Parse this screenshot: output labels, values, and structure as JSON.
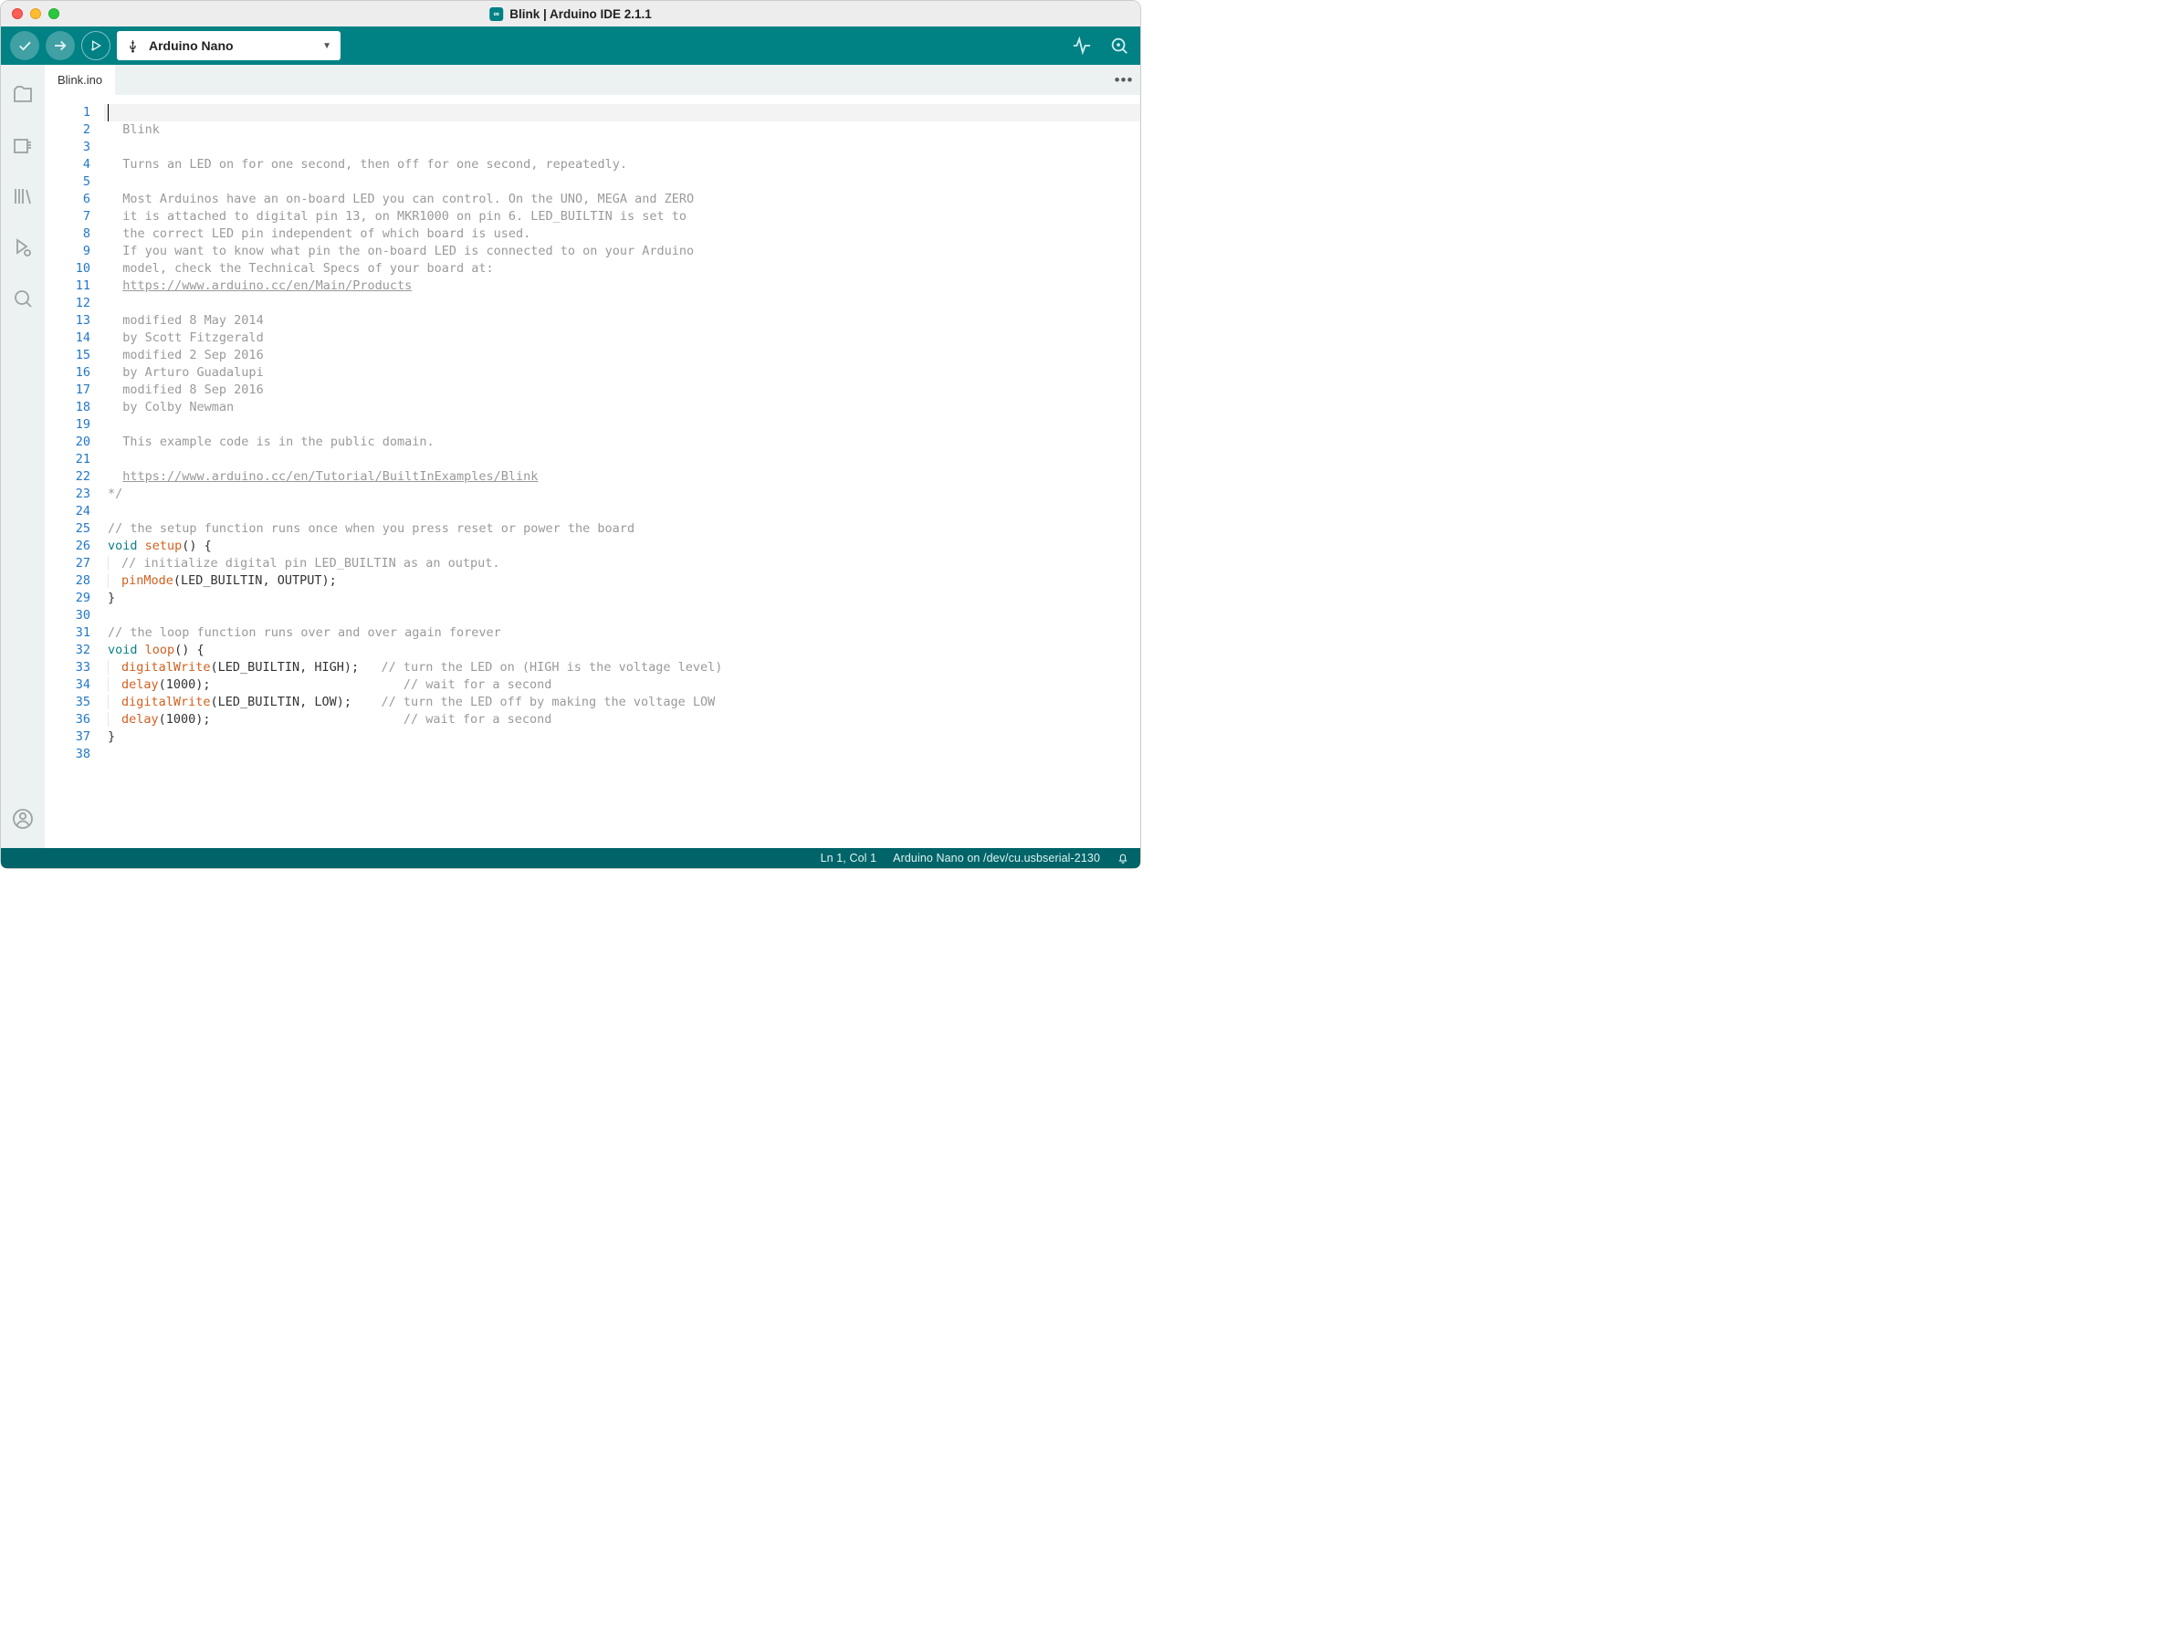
{
  "window": {
    "title": "Blink | Arduino IDE 2.1.1"
  },
  "toolbar": {
    "board_label": "Arduino Nano"
  },
  "tabs": {
    "active": "Blink.ino"
  },
  "status": {
    "position": "Ln 1, Col 1",
    "board_port": "Arduino Nano on /dev/cu.usbserial-2130"
  },
  "code": {
    "lines": [
      {
        "t": "comment",
        "text": "/*"
      },
      {
        "t": "comment",
        "indent": 1,
        "text": "Blink"
      },
      {
        "t": "blank"
      },
      {
        "t": "comment",
        "indent": 1,
        "text": "Turns an LED on for one second, then off for one second, repeatedly."
      },
      {
        "t": "blank"
      },
      {
        "t": "comment",
        "indent": 1,
        "text": "Most Arduinos have an on-board LED you can control. On the UNO, MEGA and ZERO"
      },
      {
        "t": "comment",
        "indent": 1,
        "text": "it is attached to digital pin 13, on MKR1000 on pin 6. LED_BUILTIN is set to"
      },
      {
        "t": "comment",
        "indent": 1,
        "text": "the correct LED pin independent of which board is used."
      },
      {
        "t": "comment",
        "indent": 1,
        "text": "If you want to know what pin the on-board LED is connected to on your Arduino"
      },
      {
        "t": "comment",
        "indent": 1,
        "text": "model, check the Technical Specs of your board at:"
      },
      {
        "t": "link",
        "indent": 1,
        "text": "https://www.arduino.cc/en/Main/Products"
      },
      {
        "t": "blank"
      },
      {
        "t": "comment",
        "indent": 1,
        "text": "modified 8 May 2014"
      },
      {
        "t": "comment",
        "indent": 1,
        "text": "by Scott Fitzgerald"
      },
      {
        "t": "comment",
        "indent": 1,
        "text": "modified 2 Sep 2016"
      },
      {
        "t": "comment",
        "indent": 1,
        "text": "by Arturo Guadalupi"
      },
      {
        "t": "comment",
        "indent": 1,
        "text": "modified 8 Sep 2016"
      },
      {
        "t": "comment",
        "indent": 1,
        "text": "by Colby Newman"
      },
      {
        "t": "blank"
      },
      {
        "t": "comment",
        "indent": 1,
        "text": "This example code is in the public domain."
      },
      {
        "t": "blank"
      },
      {
        "t": "link",
        "indent": 1,
        "text": "https://www.arduino.cc/en/Tutorial/BuiltInExamples/Blink"
      },
      {
        "t": "comment",
        "text": "*/"
      },
      {
        "t": "blank"
      },
      {
        "t": "lcomment",
        "text": "// the setup function runs once when you press reset or power the board"
      },
      {
        "t": "fnhead",
        "kw": "void",
        "fn": "setup",
        "tail": "() {"
      },
      {
        "t": "lcomment",
        "indent": 1,
        "guide": true,
        "text": "// initialize digital pin LED_BUILTIN as an output."
      },
      {
        "t": "call",
        "indent": 1,
        "guide": true,
        "fn": "pinMode",
        "args": "(LED_BUILTIN, OUTPUT);"
      },
      {
        "t": "plain",
        "text": "}"
      },
      {
        "t": "blank"
      },
      {
        "t": "lcomment",
        "text": "// the loop function runs over and over again forever"
      },
      {
        "t": "fnhead",
        "kw": "void",
        "fn": "loop",
        "tail": "() {"
      },
      {
        "t": "call",
        "indent": 1,
        "guide": true,
        "fn": "digitalWrite",
        "args": "(LED_BUILTIN, HIGH);",
        "pad": 3,
        "trail": "// turn the LED on (HIGH is the voltage level)"
      },
      {
        "t": "call",
        "indent": 1,
        "guide": true,
        "fn": "delay",
        "args": "(1000);",
        "pad": 26,
        "trail": "// wait for a second"
      },
      {
        "t": "call",
        "indent": 1,
        "guide": true,
        "fn": "digitalWrite",
        "args": "(LED_BUILTIN, LOW);",
        "pad": 4,
        "trail": "// turn the LED off by making the voltage LOW"
      },
      {
        "t": "call",
        "indent": 1,
        "guide": true,
        "fn": "delay",
        "args": "(1000);",
        "pad": 26,
        "trail": "// wait for a second"
      },
      {
        "t": "plain",
        "text": "}"
      },
      {
        "t": "blank"
      }
    ]
  }
}
